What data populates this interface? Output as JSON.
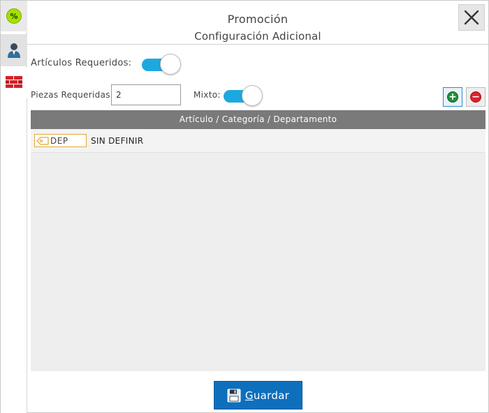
{
  "window": {
    "title": "Promoción",
    "subtitle": "Configuración Adicional"
  },
  "rail": {
    "promo_badge": "%",
    "icons": [
      "percent-badge-icon",
      "customer-icon",
      "bricks-icon"
    ]
  },
  "form": {
    "required_items_label": "Artículos Requeridos:",
    "required_items_on": true,
    "pieces_label": "Piezas Requeridas:",
    "pieces_value": "2",
    "mixed_label": "Mixto:",
    "mixed_on": true
  },
  "table": {
    "header": "Artículo / Categoría / Departamento",
    "rows": [
      {
        "tag": "DEP",
        "text": "SIN DEFINIR"
      }
    ]
  },
  "buttons": {
    "save_label": "Guardar"
  },
  "colors": {
    "accent": "#1ea8e0",
    "header_bg": "#7a7a7a",
    "save_bg": "#0e6fbc",
    "add_green": "#1f8f3a",
    "remove_red": "#e0202a",
    "tag_border": "#e3a93a"
  }
}
